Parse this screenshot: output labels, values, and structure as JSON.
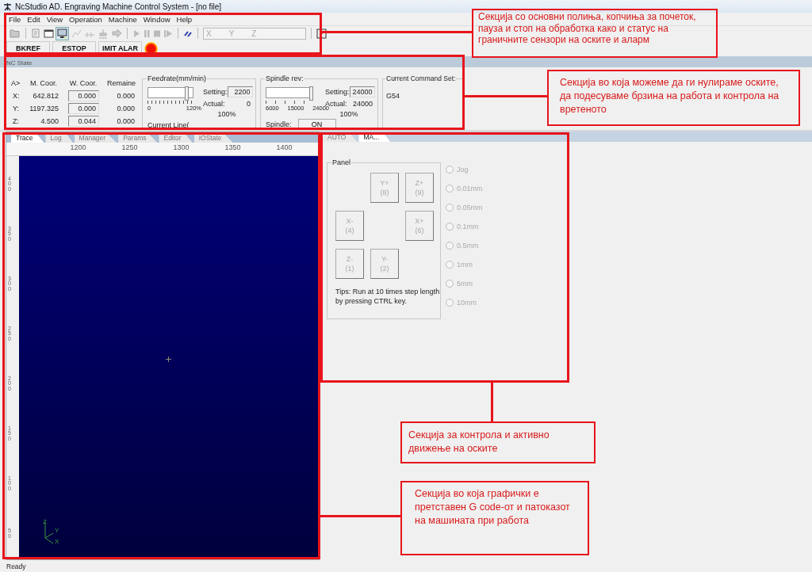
{
  "window": {
    "title": "NcStudio AD. Engraving Machine Control System  - [no file]"
  },
  "menu": [
    "File",
    "Edit",
    "View",
    "Operation",
    "Machine",
    "Window",
    "Help"
  ],
  "toolbar": {
    "coordinate_labels": [
      "X",
      "Y",
      "Z"
    ]
  },
  "status_buttons": [
    "BKREF",
    "ESTOP",
    "IMIT ALAR"
  ],
  "nc_state": {
    "title": "NC State",
    "headers": [
      "A>",
      "M. Coor.",
      "W. Coor.",
      "Remaine"
    ],
    "axes": [
      {
        "name": "X:",
        "machine": "642.812",
        "work": "0.000",
        "remain": "0.000"
      },
      {
        "name": "Y:",
        "machine": "1197.325",
        "work": "0.000",
        "remain": "0.000"
      },
      {
        "name": "Z:",
        "machine": "4.500",
        "work": "0.044",
        "remain": "0.000"
      }
    ],
    "feedrate": {
      "title": "Feedrate(mm/min)",
      "level": 0.85,
      "scale_min": "0",
      "scale_max": "120%",
      "setting_label": "Setting:",
      "setting": "2200",
      "actual_label": "Actual:",
      "actual": "0",
      "percent": "100%",
      "current_line": "Current Line("
    },
    "spindle": {
      "title": "Spindle rev:",
      "level": 1,
      "scale": [
        "6000",
        "15000",
        "24000"
      ],
      "setting_label": "Setting:",
      "setting": "24000",
      "actual_label": "Actual:",
      "actual": "24000",
      "percent": "100%",
      "spindle_label": "Spindle:",
      "button": "ON"
    },
    "command_set": {
      "title": "Current Command Set:",
      "value": "G54"
    }
  },
  "left_tabs": [
    {
      "label": "Trace",
      "selected": true
    },
    {
      "label": "Log",
      "selected": false
    },
    {
      "label": "Manager",
      "selected": false
    },
    {
      "label": "Params",
      "selected": false
    },
    {
      "label": "Editor",
      "selected": false
    },
    {
      "label": "IOState",
      "selected": false
    }
  ],
  "trace": {
    "x_ruler": [
      "1200",
      "1250",
      "1300",
      "1350",
      "1400"
    ],
    "y_ruler": [
      "400",
      "350",
      "300",
      "250",
      "200",
      "150",
      "100",
      "50"
    ],
    "axis_labels": [
      "Z",
      "Y",
      "X"
    ]
  },
  "right_tabs": [
    {
      "label": "AUTO",
      "selected": false
    },
    {
      "label": "MA...",
      "selected": true
    }
  ],
  "panel": {
    "title": "Panel",
    "jog_buttons": [
      {
        "axis": "Y+",
        "key": "(8)",
        "disabled": true
      },
      {
        "axis": "Z+",
        "key": "(9)",
        "disabled": true
      },
      {
        "axis": "X-",
        "key": "(4)",
        "disabled": true
      },
      {
        "axis": "X+",
        "key": "(6)",
        "disabled": true
      },
      {
        "axis": "Z-",
        "key": "(1)",
        "disabled": true
      },
      {
        "axis": "Y-",
        "key": "(2)",
        "disabled": true
      }
    ],
    "tips": "Tips: Run at 10 times step length by pressing CTRL key."
  },
  "step_options": [
    {
      "label": "Jog",
      "selected": false,
      "disabled": true
    },
    {
      "label": "0.01mm",
      "selected": false,
      "disabled": true
    },
    {
      "label": "0.05mm",
      "selected": false,
      "disabled": true
    },
    {
      "label": "0.1mm",
      "selected": false,
      "disabled": true
    },
    {
      "label": "0.5mm",
      "selected": false,
      "disabled": true
    },
    {
      "label": "1mm",
      "selected": false,
      "disabled": true
    },
    {
      "label": "5mm",
      "selected": false,
      "disabled": true
    },
    {
      "label": "10mm",
      "selected": false,
      "disabled": true
    }
  ],
  "status_bar": "Ready",
  "annotations": [
    "Секција со основни полиња, копчиња за почеток, пауза и стоп на обработка како и статус на граничните сензори на оските и аларм",
    "Секција во која можеме да ги нулираме оските, да подесуваме брзина на работа и контрола на вретеното",
    "Секција за контрола и активно движење на оските",
    "Секција во која графички е претставен G code-от и патоказот на машината при работа"
  ]
}
